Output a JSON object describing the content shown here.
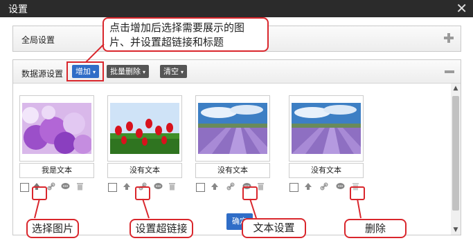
{
  "window": {
    "title": "设置",
    "close_glyph": "✕"
  },
  "global_panel": {
    "label": "全局设置",
    "expand_icon": "plus-icon"
  },
  "datasource_panel": {
    "label": "数据源设置",
    "buttons": {
      "add": "增加",
      "batch_delete": "批量删除",
      "clear": "清空",
      "dropdown_glyph": "▾"
    },
    "collapse_icon": "minus-icon"
  },
  "cards": [
    {
      "caption": "我是文本",
      "image": "purple-flowers"
    },
    {
      "caption": "没有文本",
      "image": "red-tulips"
    },
    {
      "caption": "没有文本",
      "image": "lavender-field"
    },
    {
      "caption": "没有文本",
      "image": "lavender-field"
    }
  ],
  "annotations": {
    "top_note_line1": "点击增加后选择需要展示的图",
    "top_note_line2": "片、并设置超链接和标题",
    "select_image": "选择图片",
    "set_link": "设置超链接",
    "text_setting": "文本设置",
    "delete": "删除"
  },
  "footer": {
    "ok_label": "确定"
  },
  "colors": {
    "accent": "#2f6dc7",
    "annotation": "#d9262c",
    "titlebar": "#2b2b2b"
  }
}
